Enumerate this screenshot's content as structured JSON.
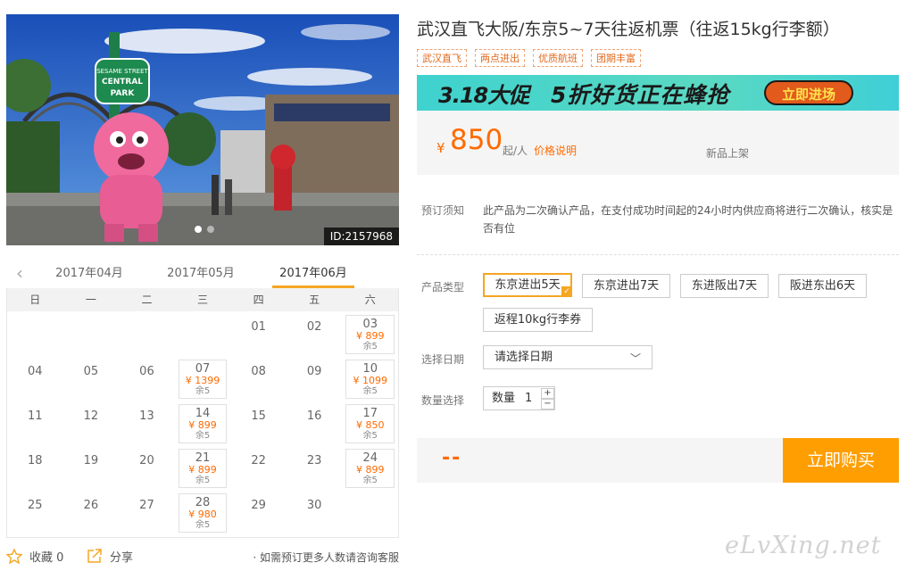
{
  "photo": {
    "id_label": "ID:2157968",
    "sign_text": [
      "SESAME STREET",
      "CENTRAL",
      "PARK"
    ],
    "slide_count": 2,
    "active_slide": 0
  },
  "months": {
    "prev_icon": "chevron-left-icon",
    "tabs": [
      "2017年04月",
      "2017年05月",
      "2017年06月"
    ],
    "active": 2
  },
  "calendar": {
    "weekdays": [
      "日",
      "一",
      "二",
      "三",
      "四",
      "五",
      "六"
    ],
    "weeks": [
      [
        null,
        null,
        null,
        null,
        {
          "day": "01"
        },
        {
          "day": "02"
        },
        {
          "day": "03",
          "price": "¥ 899",
          "stock": "余5"
        }
      ],
      [
        {
          "day": "04"
        },
        {
          "day": "05"
        },
        {
          "day": "06"
        },
        {
          "day": "07",
          "price": "¥ 1399",
          "stock": "余5"
        },
        {
          "day": "08"
        },
        {
          "day": "09"
        },
        {
          "day": "10",
          "price": "¥ 1099",
          "stock": "余5"
        }
      ],
      [
        {
          "day": "11"
        },
        {
          "day": "12"
        },
        {
          "day": "13"
        },
        {
          "day": "14",
          "price": "¥ 899",
          "stock": "余5"
        },
        {
          "day": "15"
        },
        {
          "day": "16"
        },
        {
          "day": "17",
          "price": "¥ 850",
          "stock": "余5"
        }
      ],
      [
        {
          "day": "18"
        },
        {
          "day": "19"
        },
        {
          "day": "20"
        },
        {
          "day": "21",
          "price": "¥ 899",
          "stock": "余5"
        },
        {
          "day": "22"
        },
        {
          "day": "23"
        },
        {
          "day": "24",
          "price": "¥ 899",
          "stock": "余5"
        }
      ],
      [
        {
          "day": "25"
        },
        {
          "day": "26"
        },
        {
          "day": "27"
        },
        {
          "day": "28",
          "price": "¥ 980",
          "stock": "余5"
        },
        {
          "day": "29"
        },
        {
          "day": "30"
        },
        null
      ]
    ]
  },
  "actions": {
    "favorite": "收藏 0",
    "share": "分享",
    "hint": "· 如需预订更多人数请咨询客服"
  },
  "product": {
    "title": "武汉直飞大阪/东京5~7天往返机票（往返15kg行李额）",
    "tags": [
      "武汉直飞",
      "两点进出",
      "优质航班",
      "团期丰富"
    ],
    "promo": {
      "left": "3.18大促",
      "middle": "5折好货正在蜂抢",
      "button": "立即进场"
    },
    "price": {
      "currency": "¥",
      "value": "850",
      "unit": "起/人",
      "explain": "价格说明",
      "new_tag": "新品上架"
    },
    "notice_label": "预订须知",
    "notice_text": "此产品为二次确认产品，在支付成功时间起的24小时内供应商将进行二次确认，核实是否有位",
    "type_label": "产品类型",
    "types": [
      "东京进出5天",
      "东京进出7天",
      "东进阪出7天",
      "阪进东出6天",
      "返程10kg行李券"
    ],
    "selected_type": 0,
    "date_label": "选择日期",
    "date_placeholder": "请选择日期",
    "qty_label": "数量选择",
    "qty_field_label": "数量",
    "qty_value": "1",
    "total": "--",
    "buy_button": "立即购买"
  },
  "watermark": "eLvXing.net",
  "colors": {
    "accent": "#ff6a00",
    "tab_underline": "#f5a623",
    "buy": "#ff9e00",
    "promo_bg": "#3fd2cf"
  }
}
